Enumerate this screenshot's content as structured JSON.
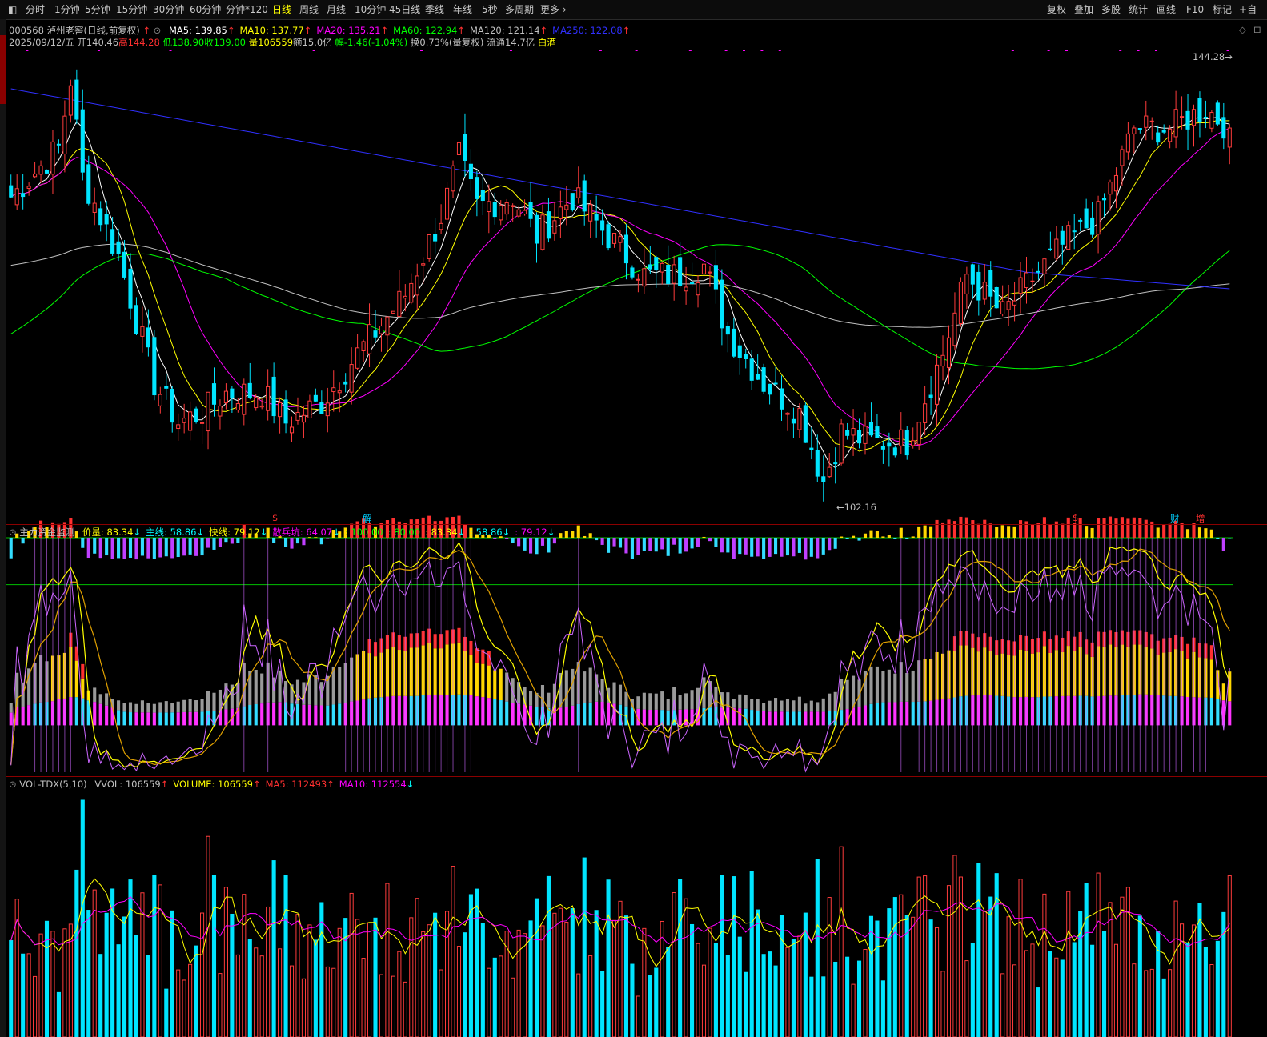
{
  "toolbar": {
    "periods": [
      "分时",
      "1分钟",
      "5分钟",
      "15分钟",
      "30分钟",
      "60分钟",
      "分钟*120",
      "日线",
      "周线",
      "月线",
      "10分钟",
      "45日线",
      "季线",
      "年线",
      "5秒",
      "多周期",
      "更多"
    ],
    "active_period": "日线",
    "right_buttons": [
      "复权",
      "叠加",
      "多股",
      "统计",
      "画线",
      "F10",
      "标记",
      "+自"
    ]
  },
  "stock": {
    "code": "000568",
    "name": "泸州老窖(日线,前复权)",
    "date": "2025/09/12/五",
    "open": "开140.46",
    "high": "高144.28",
    "low": "低138.90",
    "close": "收139.00",
    "volume": "量106559",
    "amount": "额15.0亿",
    "change": "幅-1.46(-1.04%)",
    "turnover": "换0.73%(量复权)",
    "float": "流通14.7亿",
    "sector": "白酒"
  },
  "ma_legend": [
    {
      "label": "MA5: 139.85",
      "arrow": "↑",
      "color": "#ffffff",
      "arrow_color": "#ff3030"
    },
    {
      "label": "MA10: 137.77",
      "arrow": "↑",
      "color": "#ffff00",
      "arrow_color": "#ff3030"
    },
    {
      "label": "MA20: 135.21",
      "arrow": "↑",
      "color": "#ff00ff",
      "arrow_color": "#ff3030"
    },
    {
      "label": "MA60: 122.94",
      "arrow": "↑",
      "color": "#00ff00",
      "arrow_color": "#ff3030"
    },
    {
      "label": "MA120: 121.14",
      "arrow": "↑",
      "color": "#c0c0c0",
      "arrow_color": "#ff3030"
    },
    {
      "label": "MA250: 122.08",
      "arrow": "↑",
      "color": "#3030ff",
      "arrow_color": "#ff3030"
    }
  ],
  "price_chart": {
    "high_marker": "144.28",
    "low_marker": "102.16",
    "event_markers": [
      {
        "text": "$",
        "color": "#ff3030"
      },
      {
        "text": "解",
        "color": "#00d0ff"
      },
      {
        "text": "$",
        "color": "#ff3030"
      },
      {
        "text": "财",
        "color": "#00d0ff"
      },
      {
        "text": "增",
        "color": "#ff3030"
      }
    ],
    "price_range": [
      100,
      147
    ]
  },
  "indicator": {
    "name": "主力资金监测",
    "values": [
      {
        "label": "价量: 83.34",
        "arrow": "↓",
        "color": "#ffff00",
        "arrow_color": "#00ffff"
      },
      {
        "label": "主线: 58.86",
        "arrow": "↓",
        "color": "#00ffff",
        "arrow_color": "#00ffff"
      },
      {
        "label": "快线: 79.12",
        "arrow": "↓",
        "color": "#ffff00",
        "arrow_color": "#00ffff"
      },
      {
        "label": "散兵坑: 64.07",
        "arrow": "↓",
        "color": "#ff00ff",
        "arrow_color": "#00ffff"
      },
      {
        "label": ": 100.00",
        "arrow": "",
        "color": "#00ff00",
        "arrow_color": "#00ffff"
      },
      {
        "label": ": 80.00",
        "arrow": "",
        "color": "#00ff00",
        "arrow_color": "#00ffff"
      },
      {
        "label": ": 83.34",
        "arrow": "↓",
        "color": "#ffff00",
        "arrow_color": "#00ffff"
      },
      {
        "label": ": 58.86",
        "arrow": "↓",
        "color": "#00ffff",
        "arrow_color": "#00ffff"
      },
      {
        "label": ": 79.12",
        "arrow": "↓",
        "color": "#ff00ff",
        "arrow_color": "#00ffff"
      }
    ]
  },
  "volume_pane": {
    "name": "VOL-TDX(5,10)",
    "values": [
      {
        "label": "VVOL: 106559",
        "arrow": "↑",
        "color": "#c0c0c0",
        "arrow_color": "#ff3030"
      },
      {
        "label": "VOLUME: 106559",
        "arrow": "↑",
        "color": "#ffff00",
        "arrow_color": "#ff3030"
      },
      {
        "label": "MA5: 112493",
        "arrow": "↑",
        "color": "#ff3030",
        "arrow_color": "#ff3030"
      },
      {
        "label": "MA10: 112554",
        "arrow": "↓",
        "color": "#ff00ff",
        "arrow_color": "#00ffff"
      }
    ]
  },
  "colors": {
    "up": "#ff3c3c",
    "down": "#00e5ff",
    "ma5": "#ffffff",
    "ma10": "#ffff00",
    "ma20": "#ff00ff",
    "ma60": "#00ff00",
    "ma120": "#c0c0c0",
    "ma250": "#3030ff",
    "accent": "#ffff00"
  },
  "chart_data": {
    "type": "candlestick",
    "title": "泸州老窖(日线,前复权)",
    "keypoints": [
      {
        "i": 0,
        "c": 132
      },
      {
        "i": 8,
        "c": 137
      },
      {
        "i": 10,
        "c": 144
      },
      {
        "i": 12,
        "c": 134
      },
      {
        "i": 18,
        "c": 126
      },
      {
        "i": 24,
        "c": 113
      },
      {
        "i": 28,
        "c": 109
      },
      {
        "i": 32,
        "c": 110
      },
      {
        "i": 36,
        "c": 112
      },
      {
        "i": 42,
        "c": 112
      },
      {
        "i": 46,
        "c": 109
      },
      {
        "i": 52,
        "c": 111
      },
      {
        "i": 58,
        "c": 116
      },
      {
        "i": 66,
        "c": 122
      },
      {
        "i": 72,
        "c": 130
      },
      {
        "i": 75,
        "c": 136
      },
      {
        "i": 78,
        "c": 131
      },
      {
        "i": 84,
        "c": 132
      },
      {
        "i": 88,
        "c": 128
      },
      {
        "i": 94,
        "c": 132
      },
      {
        "i": 100,
        "c": 128
      },
      {
        "i": 106,
        "c": 124
      },
      {
        "i": 112,
        "c": 124
      },
      {
        "i": 116,
        "c": 125
      },
      {
        "i": 120,
        "c": 118
      },
      {
        "i": 126,
        "c": 113
      },
      {
        "i": 132,
        "c": 110
      },
      {
        "i": 136,
        "c": 103
      },
      {
        "i": 139,
        "c": 108
      },
      {
        "i": 144,
        "c": 107
      },
      {
        "i": 150,
        "c": 107
      },
      {
        "i": 156,
        "c": 116
      },
      {
        "i": 160,
        "c": 124
      },
      {
        "i": 166,
        "c": 120
      },
      {
        "i": 170,
        "c": 123
      },
      {
        "i": 176,
        "c": 127
      },
      {
        "i": 182,
        "c": 130
      },
      {
        "i": 188,
        "c": 139
      },
      {
        "i": 194,
        "c": 139
      },
      {
        "i": 200,
        "c": 141
      },
      {
        "i": 204,
        "c": 139
      }
    ]
  }
}
